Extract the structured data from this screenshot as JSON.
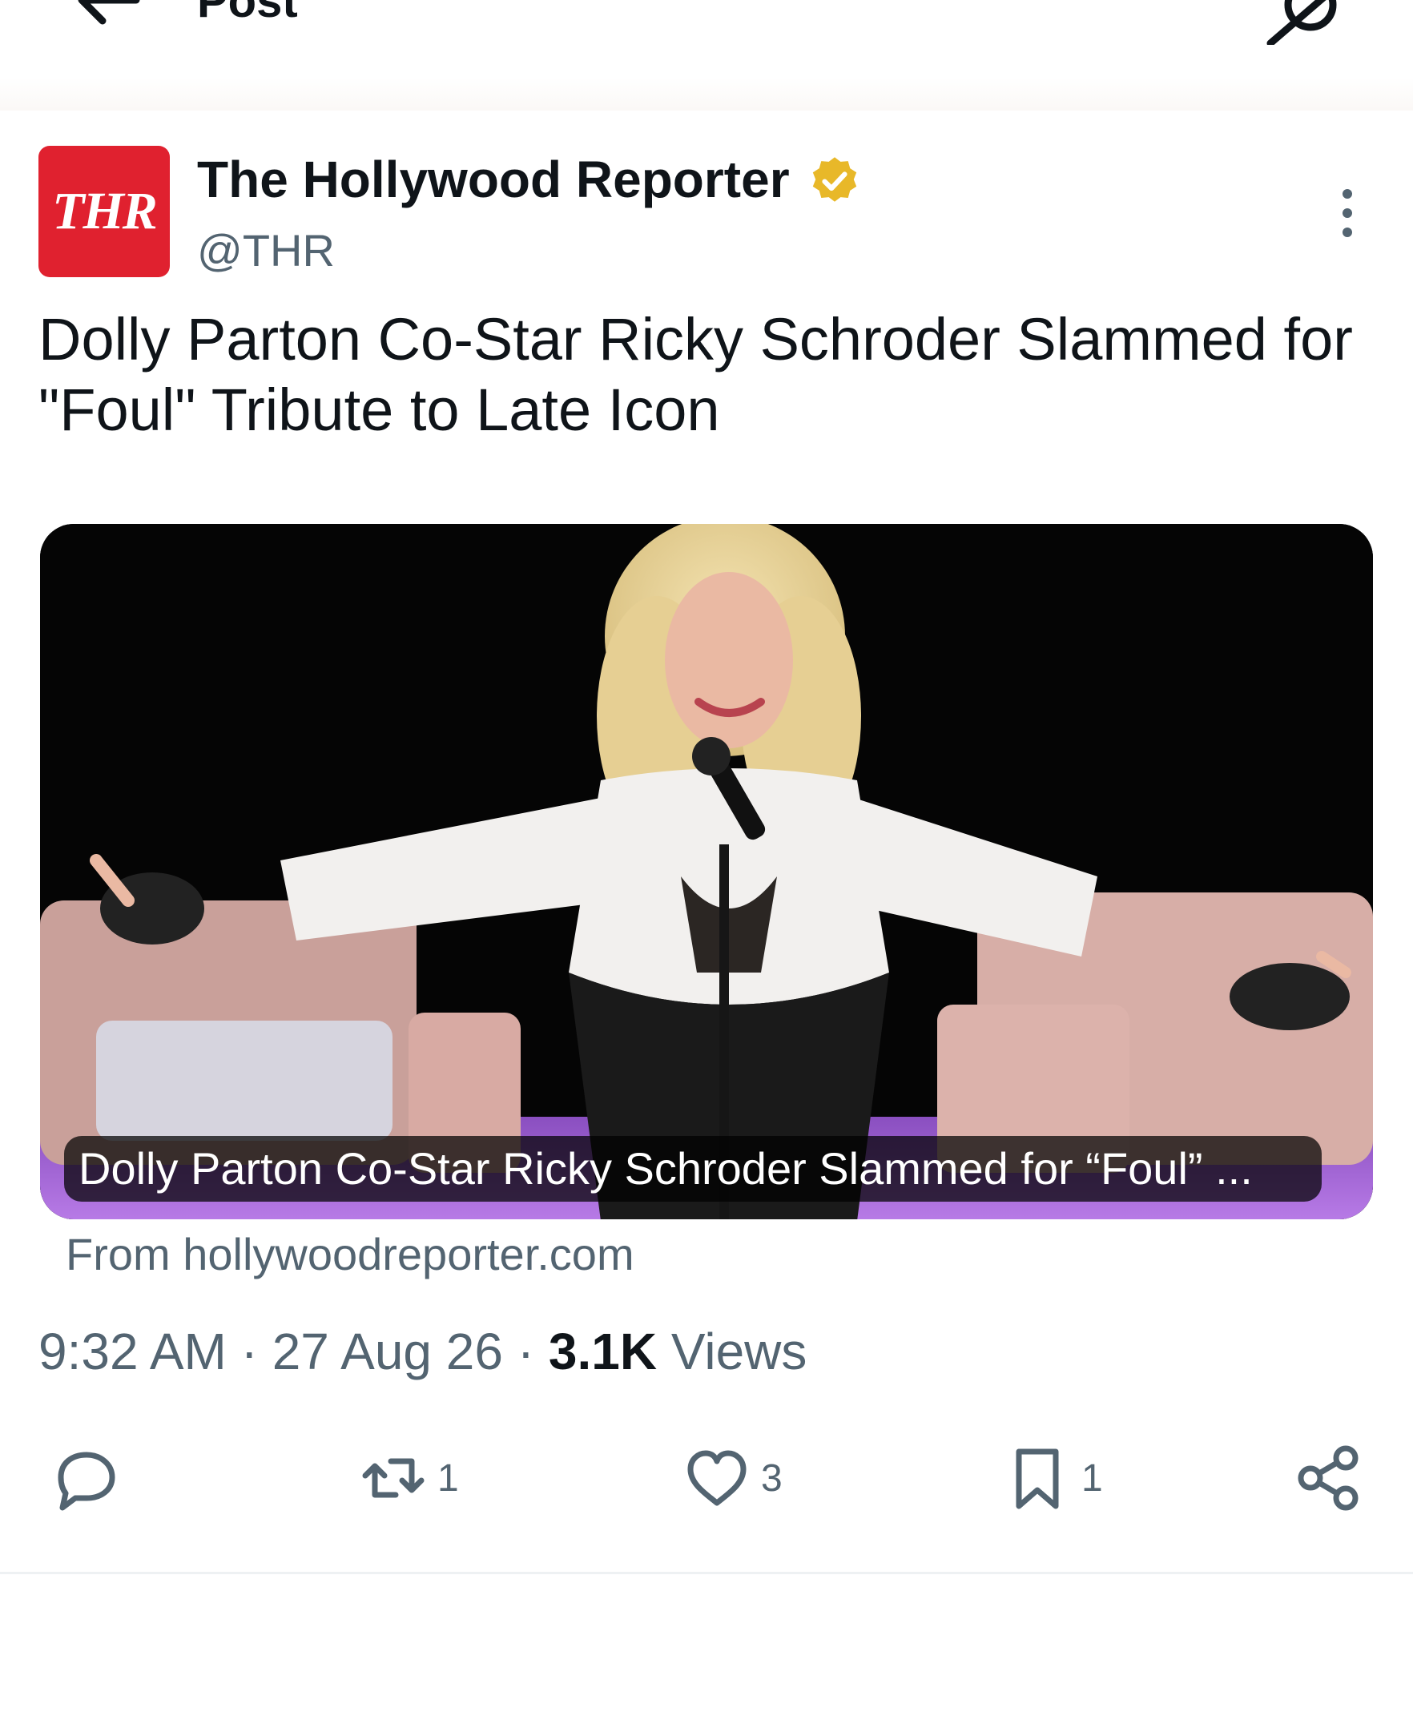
{
  "header": {
    "title": "Post",
    "back_icon": "arrow-left-icon",
    "grok_icon": "grok-icon"
  },
  "author": {
    "avatar_text": "THR",
    "name": "The Hollywood Reporter",
    "handle": "@THR",
    "verified_color": "#e8b829",
    "avatar_color": "#e0212f"
  },
  "post": {
    "text": "Dolly Parton Co-Star Ricky Schroder Slammed for\n\"Foul\" Tribute to Late Icon"
  },
  "card": {
    "caption": "Dolly Parton Co-Star Ricky Schroder Slammed for “Foul” ...",
    "source": "From hollywoodreporter.com"
  },
  "meta": {
    "time": "9:32 AM",
    "separator": " · ",
    "date": "27 Aug 26",
    "views_count": "3.1K",
    "views_label": " Views"
  },
  "actions": {
    "reply_count": "",
    "repost_count": "1",
    "like_count": "3",
    "bookmark_count": "1"
  },
  "colors": {
    "text_primary": "#0f1419",
    "text_secondary": "#536471"
  }
}
